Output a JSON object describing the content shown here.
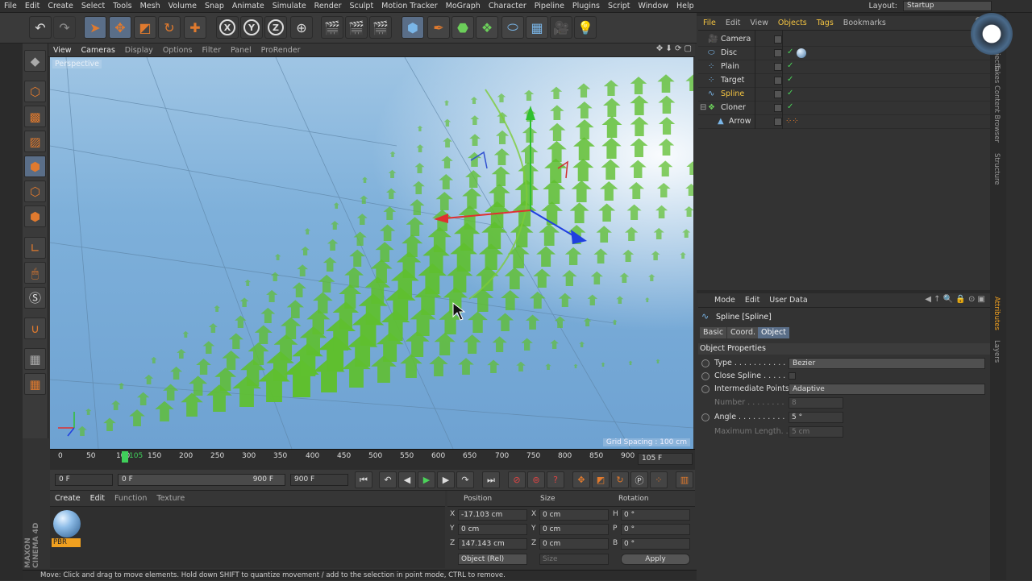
{
  "menubar": {
    "items": [
      "File",
      "Edit",
      "Create",
      "Select",
      "Tools",
      "Mesh",
      "Volume",
      "Snap",
      "Animate",
      "Simulate",
      "Render",
      "Sculpt",
      "Motion Tracker",
      "MoGraph",
      "Character",
      "Pipeline",
      "Plugins",
      "Script",
      "Window",
      "Help"
    ],
    "layout_label": "Layout:",
    "layout_value": "Startup"
  },
  "viewport": {
    "menu": [
      "View",
      "Cameras",
      "Display",
      "Options",
      "Filter",
      "Panel",
      "ProRender"
    ],
    "camera_label": "Perspective",
    "grid_label": "Grid Spacing : 100 cm"
  },
  "timeline": {
    "ticks": [
      "0",
      "50",
      "100",
      "150",
      "200",
      "250",
      "300",
      "350",
      "400",
      "450",
      "500",
      "550",
      "600",
      "650",
      "700",
      "750",
      "800",
      "850",
      "900"
    ],
    "cursor_label": "105",
    "current_frame": "105 F"
  },
  "transport": {
    "start_frame": "0 F",
    "range_start": "0 F",
    "range_end": "900 F",
    "end_frame": "900 F"
  },
  "materials": {
    "menu": [
      "Create",
      "Edit",
      "Function",
      "Texture"
    ],
    "material_name": "PBR"
  },
  "coordinates": {
    "headers": {
      "position": "Position",
      "size": "Size",
      "rotation": "Rotation"
    },
    "rows": [
      {
        "axis": "X",
        "pos": "-17.103 cm",
        "size_axis": "X",
        "size": "0 cm",
        "rot_axis": "H",
        "rot": "0 °"
      },
      {
        "axis": "Y",
        "pos": "0 cm",
        "size_axis": "Y",
        "size": "0 cm",
        "rot_axis": "P",
        "rot": "0 °"
      },
      {
        "axis": "Z",
        "pos": "147.143 cm",
        "size_axis": "Z",
        "size": "0 cm",
        "rot_axis": "B",
        "rot": "0 °"
      }
    ],
    "mode": "Object (Rel)",
    "size_mode": "Size",
    "apply": "Apply"
  },
  "status": "Move: Click and drag to move elements. Hold down SHIFT to quantize movement / add to the selection in point mode, CTRL to remove.",
  "objects": {
    "menu": [
      "File",
      "Edit",
      "View",
      "Objects",
      "Tags",
      "Bookmarks"
    ],
    "items": [
      {
        "name": "Camera",
        "indent": 0
      },
      {
        "name": "Disc",
        "indent": 0
      },
      {
        "name": "Plain",
        "indent": 0
      },
      {
        "name": "Target",
        "indent": 0
      },
      {
        "name": "Spline",
        "indent": 0
      },
      {
        "name": "Cloner",
        "indent": 0
      },
      {
        "name": "Arrow",
        "indent": 1
      }
    ]
  },
  "right_tabs": [
    "Objects",
    "Takes",
    "Content Browser",
    "Structure",
    "Attributes",
    "Layers"
  ],
  "attributes": {
    "menu": [
      "Mode",
      "Edit",
      "User Data"
    ],
    "title": "Spline [Spline]",
    "tabs": [
      "Basic",
      "Coord.",
      "Object"
    ],
    "section": "Object Properties",
    "rows": [
      {
        "label": "Type . . . . . . . . . . .",
        "value": "Bezier",
        "kind": "drop"
      },
      {
        "label": "Close Spline . . . . .",
        "value": "",
        "kind": "check"
      },
      {
        "label": "Intermediate Points",
        "value": "Adaptive",
        "kind": "drop"
      },
      {
        "label": "Number . . . . . . . .",
        "value": "8",
        "kind": "field-dim"
      },
      {
        "label": "Angle . . . . . . . . . .",
        "value": "5 °",
        "kind": "field"
      },
      {
        "label": "Maximum Length. .",
        "value": "5 cm",
        "kind": "field-dim"
      }
    ]
  },
  "brand": "MAXON CINEMA 4D",
  "colors": {
    "accent": "#f5c542",
    "selection": "#5a6e88",
    "viewport_sky": "#7eb0da",
    "arrow_green": "#5fbf2f"
  }
}
